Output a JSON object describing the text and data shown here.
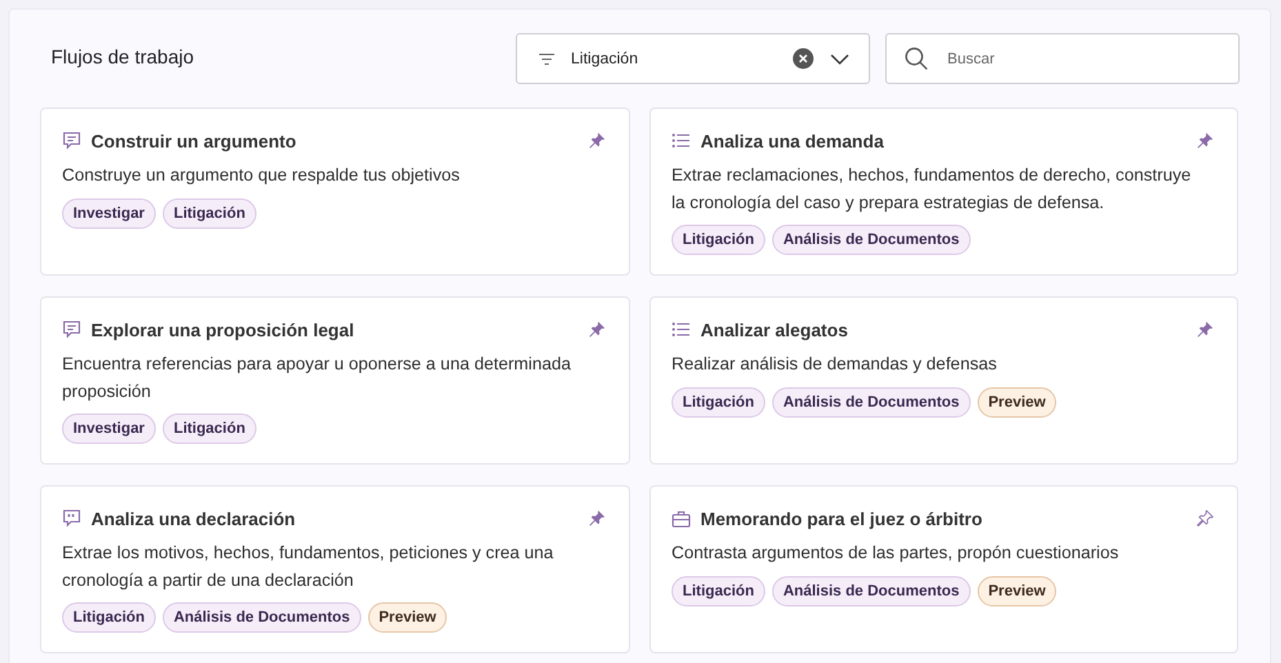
{
  "title": "Flujos de trabajo",
  "filter": {
    "value": "Litigación"
  },
  "search": {
    "placeholder": "Buscar"
  },
  "cards": [
    {
      "kind": "chat",
      "title": "Construir un argumento",
      "description": "Construye un argumento que respalde tus objetivos",
      "pinned": true,
      "tags": [
        {
          "label": "Investigar",
          "kind": "category"
        },
        {
          "label": "Litigación",
          "kind": "category"
        }
      ]
    },
    {
      "kind": "list",
      "title": "Analiza una demanda",
      "description": "Extrae reclamaciones, hechos, fundamentos de derecho, construye la cronología del caso y prepara estrategias de defensa.",
      "pinned": true,
      "tags": [
        {
          "label": "Litigación",
          "kind": "category"
        },
        {
          "label": "Análisis de Documentos",
          "kind": "category"
        }
      ]
    },
    {
      "kind": "chat",
      "title": "Explorar una proposición legal",
      "description": "Encuentra referencias para apoyar u oponerse a una determinada proposición",
      "pinned": true,
      "tags": [
        {
          "label": "Investigar",
          "kind": "category"
        },
        {
          "label": "Litigación",
          "kind": "category"
        }
      ]
    },
    {
      "kind": "list",
      "title": "Analizar alegatos",
      "description": "Realizar análisis de demandas y defensas",
      "pinned": true,
      "tags": [
        {
          "label": "Litigación",
          "kind": "category"
        },
        {
          "label": "Análisis de Documentos",
          "kind": "category"
        },
        {
          "label": "Preview",
          "kind": "preview"
        }
      ]
    },
    {
      "kind": "quote",
      "title": "Analiza una declaración",
      "description": "Extrae los motivos, hechos, fundamentos, peticiones y crea una cronología a partir de una declaración",
      "pinned": true,
      "tags": [
        {
          "label": "Litigación",
          "kind": "category"
        },
        {
          "label": "Análisis de Documentos",
          "kind": "category"
        },
        {
          "label": "Preview",
          "kind": "preview"
        }
      ]
    },
    {
      "kind": "briefcase",
      "title": "Memorando para el juez o árbitro",
      "description": "Contrasta argumentos de las partes, propón cuestionarios",
      "pinned": false,
      "tags": [
        {
          "label": "Litigación",
          "kind": "category"
        },
        {
          "label": "Análisis de Documentos",
          "kind": "category"
        },
        {
          "label": "Preview",
          "kind": "preview"
        }
      ]
    }
  ]
}
